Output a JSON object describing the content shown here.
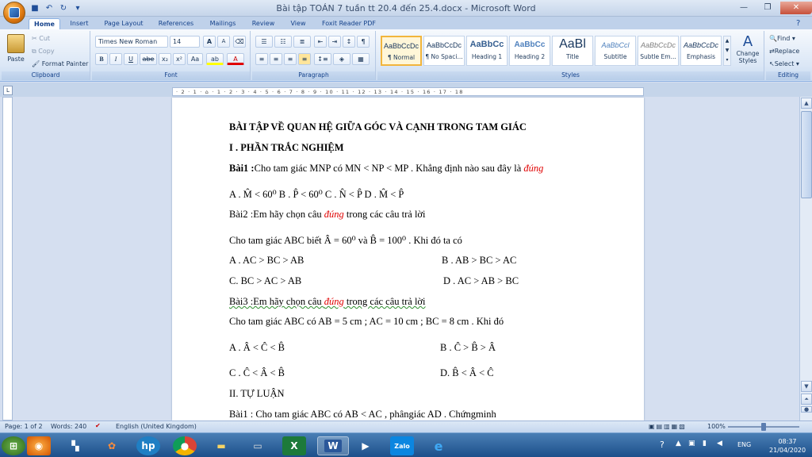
{
  "window": {
    "title": "Bài tập TOÁN 7 tuần tt 20.4 đến 25.4.docx - Microsoft Word"
  },
  "tabs": [
    "Home",
    "Insert",
    "Page Layout",
    "References",
    "Mailings",
    "Review",
    "View",
    "Foxit Reader PDF"
  ],
  "clipboard": {
    "paste": "Paste",
    "cut": "Cut",
    "copy": "Copy",
    "format_painter": "Format Painter",
    "label": "Clipboard"
  },
  "font": {
    "name": "Times New Roman",
    "size": "14",
    "label": "Font",
    "bold": "B",
    "italic": "I",
    "underline": "U",
    "strike": "abe",
    "sub": "x₂",
    "sup": "x²",
    "case": "Aa",
    "grow": "A",
    "shrink": "A"
  },
  "paragraph": {
    "label": "Paragraph"
  },
  "styles": {
    "label": "Styles",
    "items": [
      {
        "sample": "AaBbCcDc",
        "name": "¶ Normal"
      },
      {
        "sample": "AaBbCcDc",
        "name": "¶ No Spaci..."
      },
      {
        "sample": "AaBbCc",
        "name": "Heading 1"
      },
      {
        "sample": "AaBbCc",
        "name": "Heading 2"
      },
      {
        "sample": "AaBl",
        "name": "Title"
      },
      {
        "sample": "AaBbCcl",
        "name": "Subtitle"
      },
      {
        "sample": "AaBbCcDc",
        "name": "Subtle Em..."
      },
      {
        "sample": "AaBbCcDc",
        "name": "Emphasis"
      }
    ],
    "change": "Change Styles"
  },
  "editing": {
    "label": "Editing",
    "find": "Find",
    "replace": "Replace",
    "select": "Select"
  },
  "ruler": {
    "marks": "· 2 · 1 · ⌂ · 1 · 2 · 3 · 4 · 5 · 6 · 7 · 8 · 9 · 10 · 11 · 12 · 13 · 14 · 15 · 16 · 17 · 18"
  },
  "doc": {
    "title": "BÀI TẬP VỀ QUAN HỆ GIỮA GÓC VÀ CẠNH TRONG TAM GIÁC",
    "section1": "I . PHẦN TRẮC NGHIỆM",
    "b1_label": "Bài1 :",
    "b1_text": "Cho tam giác MNP có MN < NP < MP . Khẳng định nào sau đây là ",
    "correct": "đúng",
    "b1_options": "A . M̂ < 60⁰     B . P̂ < 60⁰     C . N̂ < P̂     D . M̂ < P̂",
    "b2_pre": "Bài2 :Em hãy chọn câu ",
    "b2_post": " trong các câu trả lời",
    "b2_given": "Cho tam giác ABC biết Â = 60⁰ và   B̂ = 100⁰ . Khi đó ta có",
    "b2_a": "A . AC > BC > AB",
    "b2_b": "B . AB > BC > AC",
    "b2_c": "C. BC > AC > AB",
    "b2_d": "D . AC > AB > BC",
    "b3_pre": "Bài3 :Em hãy chọn câu ",
    "b3_post": " trong các câu trả lời",
    "b3_given": "Cho tam giác ABC có AB = 5 cm ; AC = 10 cm ; BC = 8 cm  . Khi đó",
    "b3_a": "A . Â < Ĉ < B̂",
    "b3_b": "B . Ĉ > B̂ > Â",
    "b3_c": "C .   Ĉ < Â < B̂",
    "b3_d": "D.  B̂ < Â < Ĉ",
    "section2": "II. TỰ LUẬN",
    "t1": "Bài1 : Cho tam giác ABC có AB < AC , phângiác AD . Chứngminh"
  },
  "status": {
    "page": "Page: 1 of 2",
    "words": "Words: 240",
    "lang": "English (United Kingdom)",
    "zoom": "100%"
  },
  "taskbar": {
    "lang": "ENG",
    "time": "08:37",
    "date": "21/04/2020"
  },
  "colors": {
    "accent": "#15428b",
    "red": "#e00000"
  }
}
